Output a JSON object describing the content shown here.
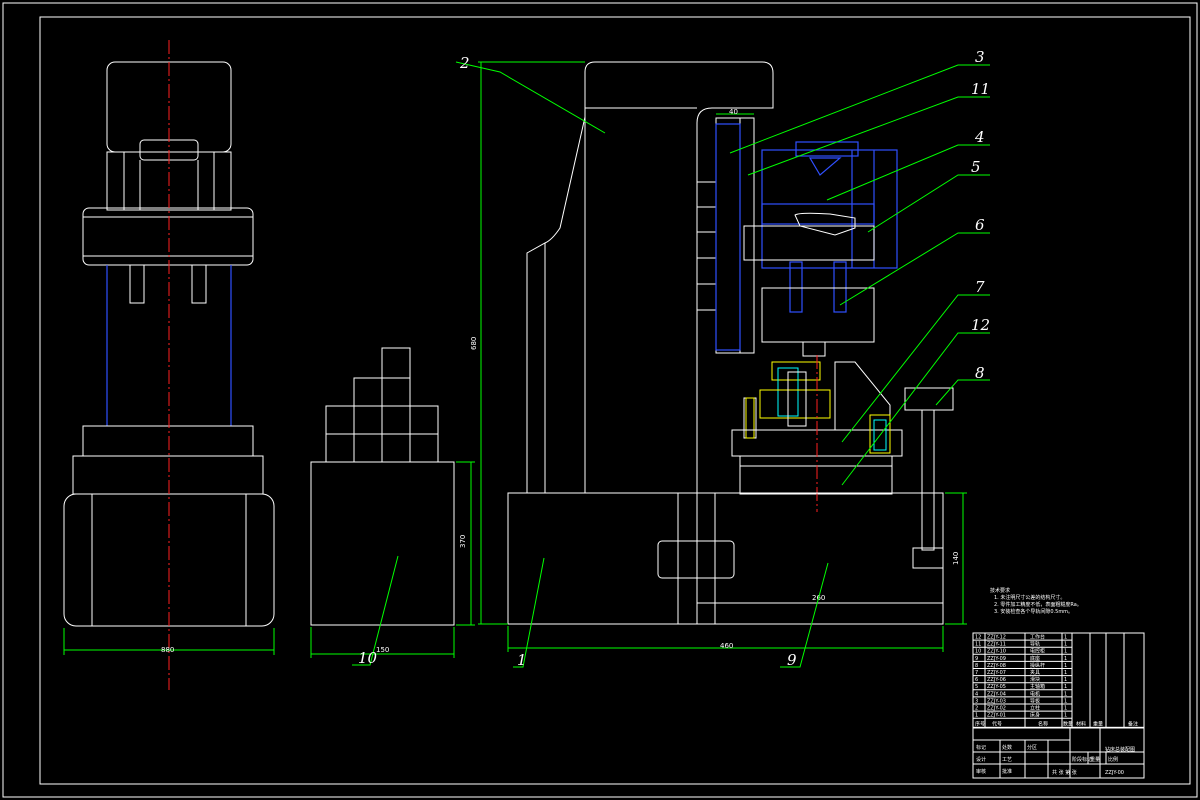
{
  "labels": [
    "1",
    "2",
    "3",
    "4",
    "5",
    "6",
    "7",
    "8",
    "9",
    "10",
    "11",
    "12"
  ],
  "dimensions": {
    "left_width": "880",
    "box_width": "150",
    "box_height": "370",
    "total_height": "680",
    "base_width": "460",
    "base_height": "140",
    "inner_width": "260",
    "slide_width": "40"
  },
  "notes": {
    "title": "技术要求",
    "lines": [
      "1. 未注明尺寸公差的结构尺寸。",
      "2. 零件加工精度不低，表面粗糙度Ra。",
      "3. 安装检查各个导轨间隙0.5mm。"
    ]
  },
  "parts_list": [
    {
      "no": "12",
      "code": "ZZJY-12",
      "name": "工作台",
      "qty": "1"
    },
    {
      "no": "11",
      "code": "ZZJY-11",
      "name": "导轨",
      "qty": "1"
    },
    {
      "no": "10",
      "code": "ZZJY-10",
      "name": "电控柜",
      "qty": "1"
    },
    {
      "no": "9",
      "code": "ZZJY-09",
      "name": "底座",
      "qty": "1"
    },
    {
      "no": "8",
      "code": "ZZJY-08",
      "name": "操纵杆",
      "qty": "1"
    },
    {
      "no": "7",
      "code": "ZZJY-07",
      "name": "夹具",
      "qty": "1"
    },
    {
      "no": "6",
      "code": "ZZJY-06",
      "name": "滑块",
      "qty": "1"
    },
    {
      "no": "5",
      "code": "ZZJY-05",
      "name": "主轴箱",
      "qty": "1"
    },
    {
      "no": "4",
      "code": "ZZJY-04",
      "name": "电机",
      "qty": "1"
    },
    {
      "no": "3",
      "code": "ZZJY-03",
      "name": "导板",
      "qty": "1"
    },
    {
      "no": "2",
      "code": "ZZJY-02",
      "name": "立柱",
      "qty": "1"
    },
    {
      "no": "1",
      "code": "ZZJY-01",
      "name": "床身",
      "qty": "1"
    }
  ],
  "parts_header": {
    "no": "序号",
    "code": "代号",
    "name": "名称",
    "qty": "数量",
    "material": "材料",
    "weight": "重量",
    "remark": "备注"
  },
  "title_block": {
    "title": "钻床总装配图",
    "drawing_no": "ZZJY-00",
    "scale_label": "比例",
    "sheet_label": "共 张 第 张",
    "rows": [
      "标记",
      "处数",
      "分区",
      "更改文件号",
      "签名",
      "年月日"
    ],
    "roles": [
      "设计",
      "审核",
      "工艺",
      "批准"
    ],
    "stage": "阶段标记",
    "weight": "重量"
  },
  "colors": {
    "outline": "#ffffff",
    "leader": "#00ff00",
    "hidden": "#3050ff",
    "center": "#ff2020",
    "detail": "#ffff00"
  }
}
